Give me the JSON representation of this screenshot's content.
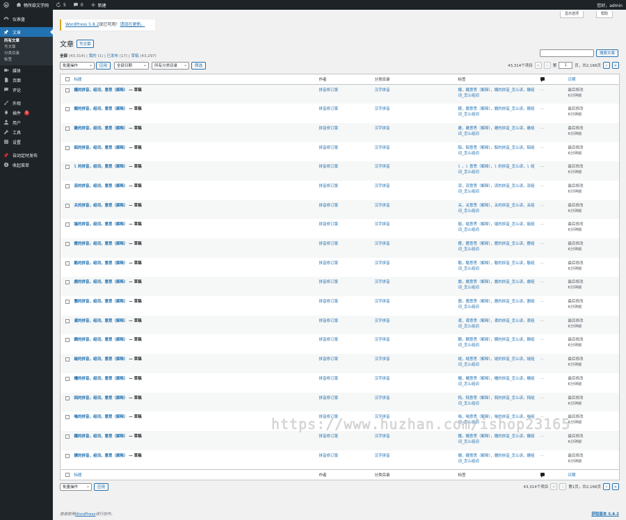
{
  "adminbar": {
    "site_name": "畅所欲文学网",
    "updates_count": "5",
    "comments_count": "0",
    "new_label": "新建",
    "greeting": "您好，admin"
  },
  "sidebar": {
    "dashboard": "仪表盘",
    "posts": "文章",
    "posts_sub": [
      "所有文章",
      "写文章",
      "分类目录",
      "标签"
    ],
    "media": "媒体",
    "pages": "页面",
    "comments": "评论",
    "appearance": "外观",
    "plugins": "插件",
    "plugins_badge": "1",
    "users": "用户",
    "tools": "工具",
    "settings": "设置",
    "auto_publish": "自动定时发布",
    "collapse": "收起菜单"
  },
  "screen_options": "显示选项",
  "help": "帮助",
  "notice": {
    "link1": "WordPress 5.8.2",
    "text": "现已可用！",
    "link2": "请现在更新。"
  },
  "page_title": "文章",
  "add_new": "写文章",
  "views": {
    "all": "全部",
    "all_count": "(43,314)",
    "mine": "我的",
    "mine_count": "(1)",
    "published": "已发布",
    "published_count": "(17)",
    "draft": "草稿",
    "draft_count": "(43,297)"
  },
  "search_button": "搜索文章",
  "bulk_actions": "批量操作",
  "apply": "应用",
  "all_dates": "全部日期",
  "all_categories": "所有分类目录",
  "filter": "筛选",
  "items_count": "43,314个项目",
  "page_prefix": "第",
  "current_page": "1",
  "page_suffix": "页，共2,166页",
  "bottom_page_text": "第1页，共2,166页",
  "columns": {
    "title": "标题",
    "author": "作者",
    "categories": "分类目录",
    "tags": "标签",
    "date": "日期"
  },
  "rows": [
    {
      "title": "鐵的拼音，组词，意思（解释）",
      "status": "— 草稿",
      "author": "拼音修订版",
      "category": "汉字拼音",
      "tags": "鐵，鐵意思（解释），鐵的拼音_怎么读，鐵组词_怎么组词",
      "dash": "—",
      "date1": "最后修改",
      "date2": "6分钟前"
    },
    {
      "title": "鏡的拼音，组词，意思（解释）",
      "status": "— 草稿",
      "author": "拼音修订版",
      "category": "汉字拼音",
      "tags": "鏡，鏡意思（解释），鏡的拼音_怎么读，鏡组词_怎么组词",
      "dash": "—",
      "date1": "最后修改",
      "date2": "6分钟前"
    },
    {
      "title": "雞的拼音，组词，意思（解释）",
      "status": "— 草稿",
      "author": "拼音修订版",
      "category": "汉字拼音",
      "tags": "雞，雞意思（解释），雞的拼音_怎么读，雞组词_怎么组词",
      "dash": "—",
      "date1": "最后修改",
      "date2": "6分钟前"
    },
    {
      "title": "鋁的拼音，组词，意思（解释）",
      "status": "— 草稿",
      "author": "拼音修订版",
      "category": "汉字拼音",
      "tags": "鋁，鋁意思（解释），鋁的拼音_怎么读，鋁组词_怎么组词",
      "dash": "—",
      "date1": "最后修改",
      "date2": "6分钟前"
    },
    {
      "title": "讠的拼音，组词，意思（解释）",
      "status": "— 草稿",
      "author": "拼音修订版",
      "category": "汉字拼音",
      "tags": "讠，讠意思（解释），讠的拼音_怎么读，讠组词_怎么组词",
      "dash": "—",
      "date1": "最后修改",
      "date2": "6分钟前"
    },
    {
      "title": "涙的拼音，组词，意思（解释）",
      "status": "— 草稿",
      "author": "拼音修订版",
      "category": "汉字拼音",
      "tags": "涙，涙意思（解释），涙的拼音_怎么读，涙组词_怎么组词",
      "dash": "—",
      "date1": "最后修改",
      "date2": "6分钟前"
    },
    {
      "title": "关的拼音，组词，意思（解释）",
      "status": "— 草稿",
      "author": "拼音修订版",
      "category": "汉字拼音",
      "tags": "关，关意思（解释），关的拼音_怎么读，关组词_怎么组词",
      "dash": "—",
      "date1": "最后修改",
      "date2": "6分钟前"
    },
    {
      "title": "謳的拼音，组词，意思（解释）",
      "status": "— 草稿",
      "author": "拼音修订版",
      "category": "汉字拼音",
      "tags": "謳，謳意思（解释），謳的拼音_怎么读，謳组词_怎么组词",
      "dash": "—",
      "date1": "最后修改",
      "date2": "6分钟前"
    },
    {
      "title": "鐙的拼音，组词，意思（解释）",
      "status": "— 草稿",
      "author": "拼音修订版",
      "category": "汉字拼音",
      "tags": "鐙，鐙意思（解释），鐙的拼音_怎么读，鐙组词_怎么组词",
      "dash": "—",
      "date1": "最后修改",
      "date2": "6分钟前"
    },
    {
      "title": "駱的拼音，组词，意思（解释）",
      "status": "— 草稿",
      "author": "拼音修订版",
      "category": "汉字拼音",
      "tags": "駱，駱意思（解释），駱的拼音_怎么读，駱组词_怎么组词",
      "dash": "—",
      "date1": "最后修改",
      "date2": "6分钟前"
    },
    {
      "title": "戲的拼音，组词，意思（解释）",
      "status": "— 草稿",
      "author": "拼音修订版",
      "category": "汉字拼音",
      "tags": "戲，戲意思（解释），戲的拼音_怎么读，戲组词_怎么组词",
      "dash": "—",
      "date1": "最后修改",
      "date2": "6分钟前"
    },
    {
      "title": "圊的拼音，组词，意思（解释）",
      "status": "— 草稿",
      "author": "拼音修订版",
      "category": "汉字拼音",
      "tags": "圊，圊意思（解释），圊的拼音_怎么读，圊组词_怎么组词",
      "dash": "—",
      "date1": "最后修改",
      "date2": "6分钟前"
    },
    {
      "title": "鳶的拼音，组词，意思（解释）",
      "status": "— 草稿",
      "author": "拼音修订版",
      "category": "汉字拼音",
      "tags": "鳶，鳶意思（解释），鳶的拼音_怎么读，鳶组词_怎么组词",
      "dash": "—",
      "date1": "最后修改",
      "date2": "6分钟前"
    },
    {
      "title": "鋼的拼音，组词，意思（解释）",
      "status": "— 草稿",
      "author": "拼音修订版",
      "category": "汉字拼音",
      "tags": "鋼，鋼意思（解释），鋼的拼音_怎么读，鋼组词_怎么组词",
      "dash": "—",
      "date1": "最后修改",
      "date2": "6分钟前"
    },
    {
      "title": "縫的拼音，组词，意思（解释）",
      "status": "— 草稿",
      "author": "拼音修订版",
      "category": "汉字拼音",
      "tags": "縫，縫意思（解释），縫的拼音_怎么读，縫组词_怎么组词",
      "dash": "—",
      "date1": "最后修改",
      "date2": "6分钟前"
    },
    {
      "title": "櫃的拼音，组词，意思（解释）",
      "status": "— 草稿",
      "author": "拼音修订版",
      "category": "汉字拼音",
      "tags": "櫃，櫃意思（解释），櫃的拼音_怎么读，櫃组词_怎么组词",
      "dash": "—",
      "date1": "最后修改",
      "date2": "6分钟前"
    },
    {
      "title": "鈍的拼音，组词，意思（解释）",
      "status": "— 草稿",
      "author": "拼音修订版",
      "category": "汉字拼音",
      "tags": "鈍，鈍意思（解释），鈍的拼音_怎么读，鈍组词_怎么组词",
      "dash": "—",
      "date1": "最后修改",
      "date2": "6分钟前"
    },
    {
      "title": "嗡的拼音，组词，意思（解释）",
      "status": "— 草稿",
      "author": "拼音修订版",
      "category": "汉字拼音",
      "tags": "嗡，嗡意思（解释），嗡的拼音_怎么读，嗡组词_怎么组词",
      "dash": "—",
      "date1": "最后修改",
      "date2": "6分钟前"
    },
    {
      "title": "鐵的拼音，组词，意思（解释）",
      "status": "— 草稿",
      "author": "拼音修订版",
      "category": "汉字拼音",
      "tags": "鐵，鐵意思（解释），鐵的拼音_怎么读，鐵组词_怎么组词",
      "dash": "—",
      "date1": "最后修改",
      "date2": "6分钟前"
    },
    {
      "title": "鏝的拼音，组词，意思（解释）",
      "status": "— 草稿",
      "author": "拼音修订版",
      "category": "汉字拼音",
      "tags": "鏝，鏝意思（解释），鏝的拼音_怎么读，鏝组词_怎么组词",
      "dash": "—",
      "date1": "最后修改",
      "date2": "6分钟前"
    }
  ],
  "footer": {
    "prefix": "感谢使用",
    "link": "WordPress",
    "suffix": "进行创作。",
    "version": "获取版本 5.8.2"
  },
  "watermark": "https://www.huzhan.com/ishop23165",
  "colors": {
    "admin_bg": "#1d2327",
    "accent": "#2271b1",
    "badge": "#d63638",
    "notice": "#dba617"
  }
}
